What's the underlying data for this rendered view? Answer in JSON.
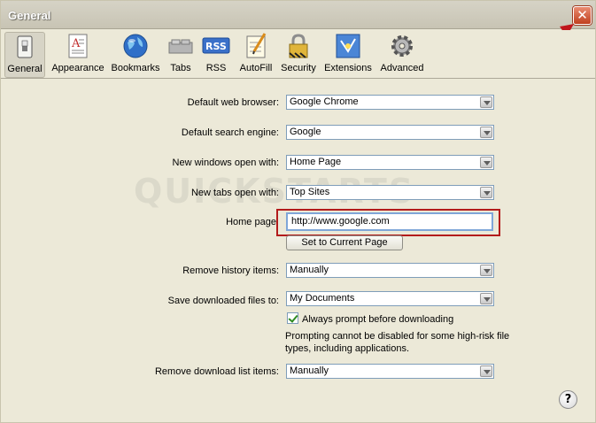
{
  "window": {
    "title": "General",
    "close_glyph": "✕"
  },
  "toolbar": {
    "items": [
      {
        "label": "General",
        "icon": "switch-icon"
      },
      {
        "label": "Appearance",
        "icon": "font-page-icon"
      },
      {
        "label": "Bookmarks",
        "icon": "globe-icon"
      },
      {
        "label": "Tabs",
        "icon": "tabs-icon"
      },
      {
        "label": "RSS",
        "icon": "rss-icon",
        "badge": "RSS"
      },
      {
        "label": "AutoFill",
        "icon": "pencil-form-icon"
      },
      {
        "label": "Security",
        "icon": "lock-icon"
      },
      {
        "label": "Extensions",
        "icon": "puzzle-icon"
      },
      {
        "label": "Advanced",
        "icon": "gear-icon"
      }
    ]
  },
  "settings": {
    "default_browser": {
      "label": "Default web browser:",
      "value": "Google Chrome"
    },
    "search_engine": {
      "label": "Default search engine:",
      "value": "Google"
    },
    "new_windows": {
      "label": "New windows open with:",
      "value": "Home Page"
    },
    "new_tabs": {
      "label": "New tabs open with:",
      "value": "Top Sites"
    },
    "home_page": {
      "label": "Home page:",
      "value": "http://www.google.com"
    },
    "set_current_button": "Set to Current Page",
    "remove_history": {
      "label": "Remove history items:",
      "value": "Manually"
    },
    "save_downloads": {
      "label": "Save downloaded files to:",
      "value": "My Documents"
    },
    "always_prompt": {
      "label": "Always prompt before downloading",
      "checked": true
    },
    "prompt_note_line1": "Prompting cannot be disabled for some high-risk file",
    "prompt_note_line2": "types, including applications.",
    "remove_download_list": {
      "label": "Remove download list items:",
      "value": "Manually"
    }
  },
  "help": {
    "glyph": "?"
  },
  "watermark": "QUICKSTARTS",
  "colors": {
    "highlight": "#b31b1b",
    "arrow": "#c0161b",
    "close": "#c0401f"
  }
}
